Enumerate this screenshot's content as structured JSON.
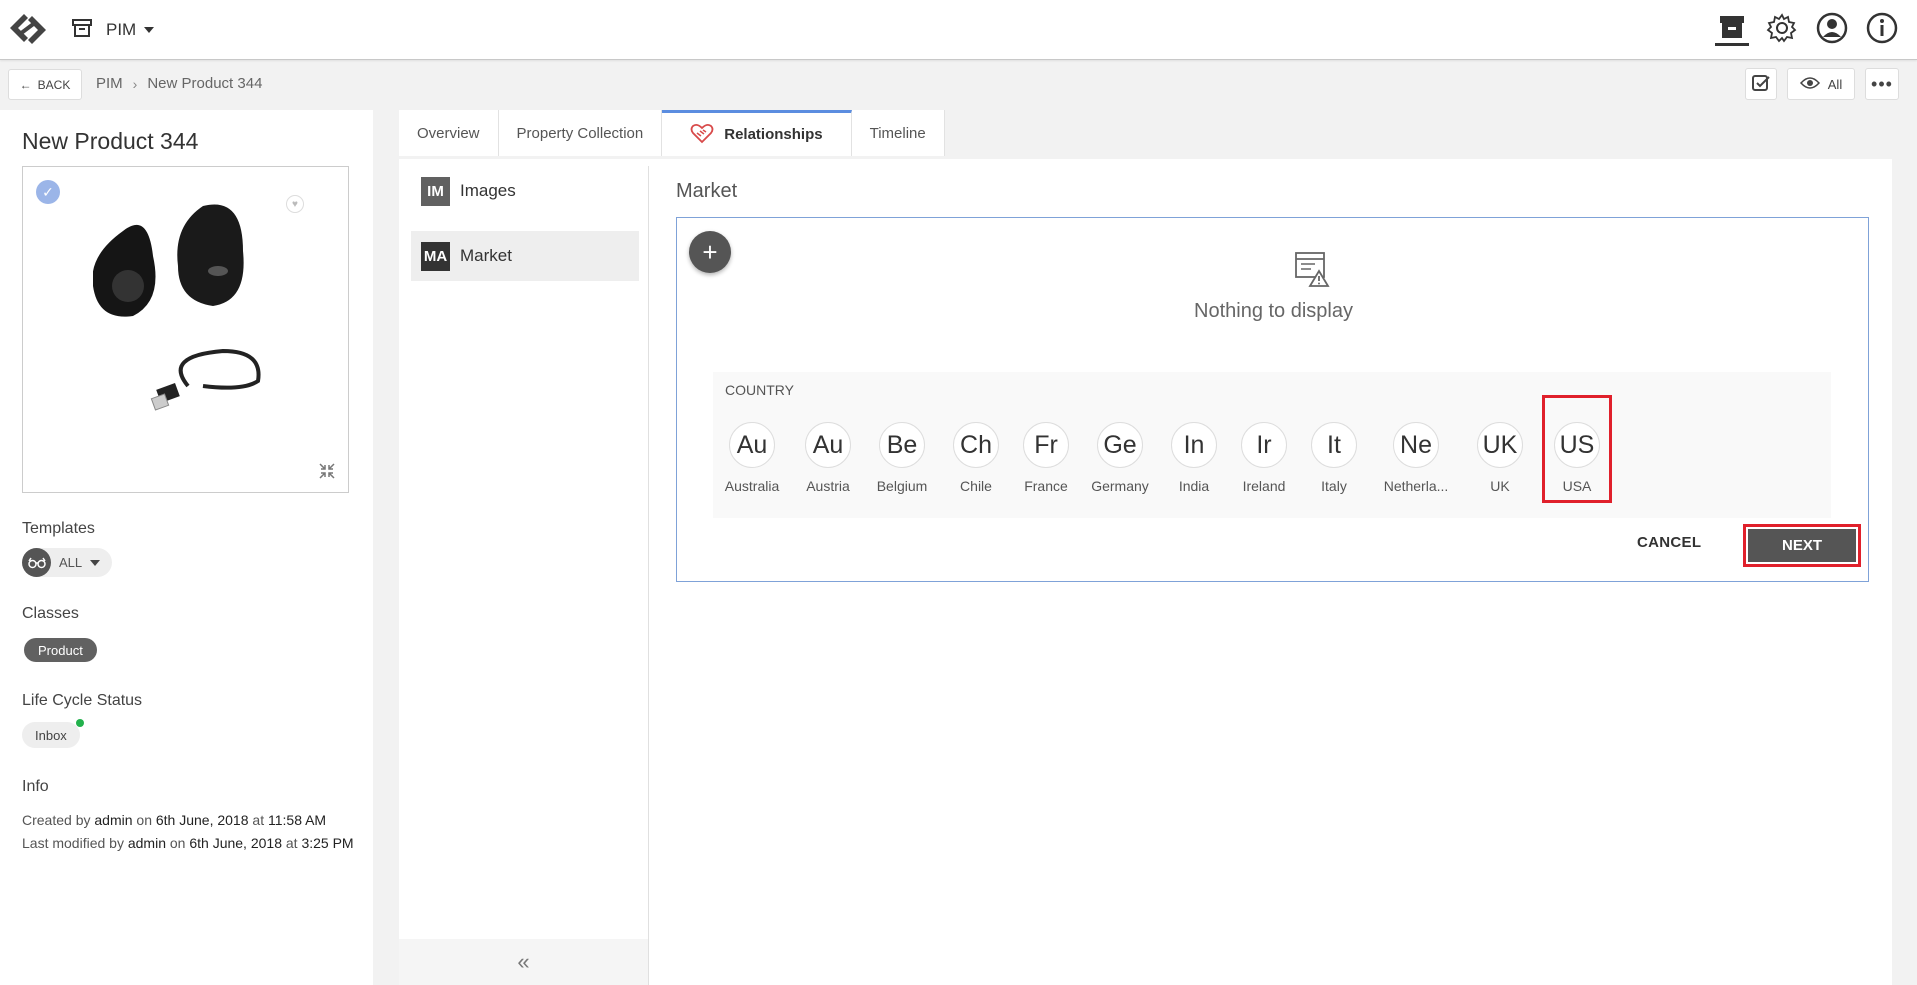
{
  "app": {
    "name": "PIM"
  },
  "topbar": {
    "icons": [
      "archive-active-icon",
      "gear-icon",
      "user-icon",
      "info-icon"
    ]
  },
  "subbar": {
    "back_label": "BACK",
    "breadcrumb": [
      "PIM",
      "New Product 344"
    ],
    "view_label": "All"
  },
  "product": {
    "title": "New Product 344",
    "templates_label": "Templates",
    "template_value": "ALL",
    "classes_label": "Classes",
    "class_value": "Product",
    "lifecycle_label": "Life Cycle Status",
    "lifecycle_value": "Inbox",
    "info_label": "Info",
    "created": {
      "prefix": "Created by",
      "user": "admin",
      "on": "on",
      "date": "6th June, 2018",
      "at": "at",
      "time": "11:58 AM"
    },
    "modified": {
      "prefix": "Last modified by",
      "user": "admin",
      "on": "on",
      "date": "6th June, 2018",
      "at": "at",
      "time": "3:25 PM"
    }
  },
  "tabs": [
    "Overview",
    "Property Collection",
    "Relationships",
    "Timeline"
  ],
  "relationships": [
    {
      "code": "IM",
      "label": "Images",
      "color": "#616161"
    },
    {
      "code": "MA",
      "label": "Market",
      "color": "#333333"
    }
  ],
  "market": {
    "title": "Market",
    "empty_text": "Nothing to display",
    "country_label": "COUNTRY",
    "countries": [
      {
        "abbr": "Au",
        "name": "Australia"
      },
      {
        "abbr": "Au",
        "name": "Austria"
      },
      {
        "abbr": "Be",
        "name": "Belgium"
      },
      {
        "abbr": "Ch",
        "name": "Chile"
      },
      {
        "abbr": "Fr",
        "name": "France"
      },
      {
        "abbr": "Ge",
        "name": "Germany"
      },
      {
        "abbr": "In",
        "name": "India"
      },
      {
        "abbr": "Ir",
        "name": "Ireland"
      },
      {
        "abbr": "It",
        "name": "Italy"
      },
      {
        "abbr": "Ne",
        "name": "Netherla..."
      },
      {
        "abbr": "UK",
        "name": "UK"
      },
      {
        "abbr": "US",
        "name": "USA"
      }
    ],
    "cancel_label": "CANCEL",
    "next_label": "NEXT"
  },
  "colors": {
    "accent": "#5b8de0",
    "highlight": "#e0202b",
    "dark_button": "#555555",
    "status_dot": "#22b14c"
  }
}
